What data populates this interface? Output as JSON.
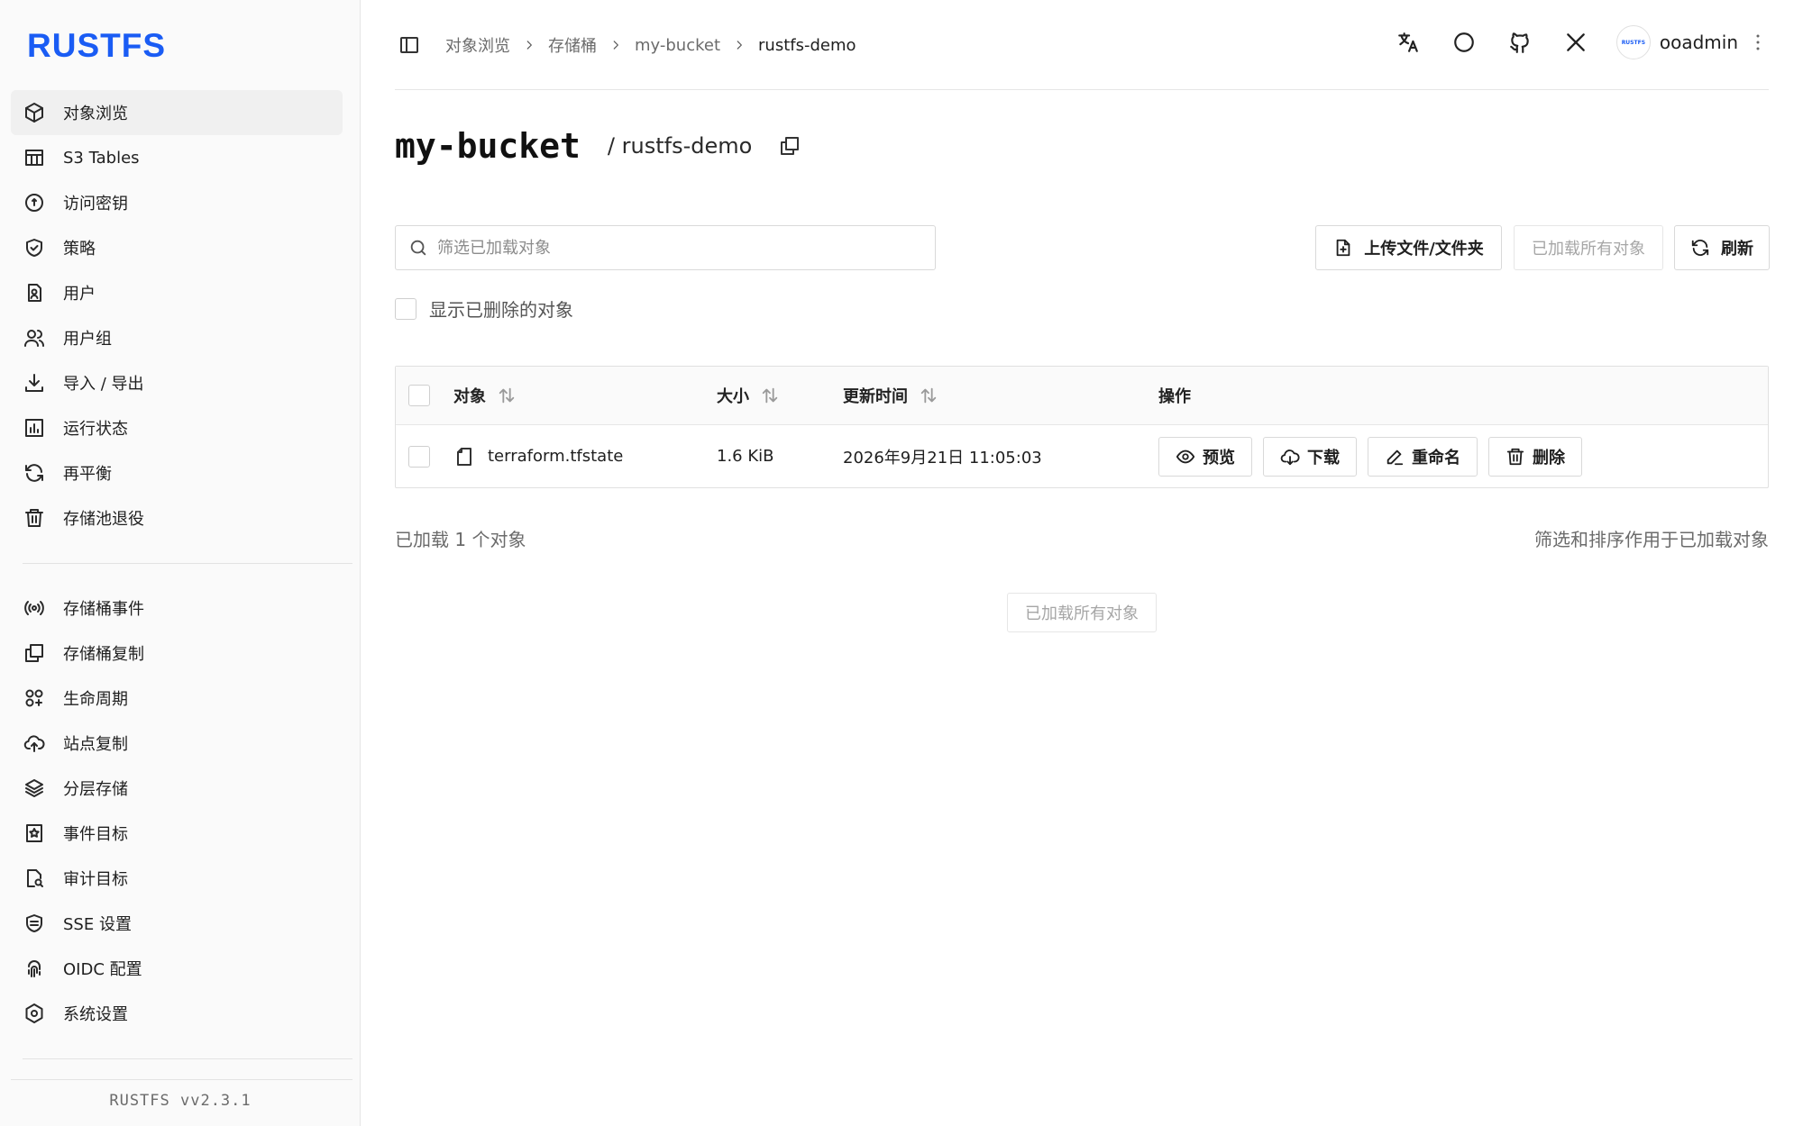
{
  "app": {
    "logo": "RUSTFS",
    "version": "RUSTFS  vv2.3.1",
    "accent": "#1a5cf4"
  },
  "sidebar": {
    "primary": [
      {
        "label": "对象浏览",
        "icon": "cube-icon",
        "active": true
      },
      {
        "label": "S3 Tables",
        "icon": "table-icon"
      },
      {
        "label": "访问密钥",
        "icon": "key-circle-icon"
      },
      {
        "label": "策略",
        "icon": "shield-check-icon"
      },
      {
        "label": "用户",
        "icon": "user-badge-icon"
      },
      {
        "label": "用户组",
        "icon": "users-icon"
      },
      {
        "label": "导入 / 导出",
        "icon": "download-tray-icon"
      },
      {
        "label": "运行状态",
        "icon": "bar-chart-icon"
      },
      {
        "label": "再平衡",
        "icon": "refresh-icon"
      },
      {
        "label": "存储池退役",
        "icon": "trash-icon"
      }
    ],
    "secondary": [
      {
        "label": "存储桶事件",
        "icon": "broadcast-icon"
      },
      {
        "label": "存储桶复制",
        "icon": "copy-icon"
      },
      {
        "label": "生命周期",
        "icon": "lifecycle-icon"
      },
      {
        "label": "站点复制",
        "icon": "cloud-upload-icon"
      },
      {
        "label": "分层存储",
        "icon": "layers-icon"
      },
      {
        "label": "事件目标",
        "icon": "star-bookmark-icon"
      },
      {
        "label": "审计目标",
        "icon": "file-search-icon"
      },
      {
        "label": "SSE 设置",
        "icon": "encryption-icon"
      },
      {
        "label": "OIDC 配置",
        "icon": "fingerprint-icon"
      },
      {
        "label": "系统设置",
        "icon": "hex-settings-icon"
      }
    ]
  },
  "header": {
    "breadcrumb": [
      "对象浏览",
      "存储桶",
      "my-bucket",
      "rustfs-demo"
    ],
    "user": {
      "name": "ooadmin",
      "avatar_text": "RUSTFS"
    }
  },
  "page": {
    "bucket": "my-bucket",
    "path": "/ rustfs-demo"
  },
  "toolbar": {
    "search_placeholder": "筛选已加载对象",
    "upload_label": "上传文件/文件夹",
    "load_all_label": "已加载所有对象",
    "refresh_label": "刷新",
    "show_deleted_label": "显示已删除的对象"
  },
  "table": {
    "columns": {
      "name": "对象",
      "size": "大小",
      "time": "更新时间",
      "ops": "操作"
    },
    "rows": [
      {
        "name": "terraform.tfstate",
        "size": "1.6 KiB",
        "updated": "2026年9月21日 11:05:03",
        "ops": {
          "preview": "预览",
          "download": "下载",
          "rename": "重命名",
          "delete": "删除"
        }
      }
    ]
  },
  "footer": {
    "loaded_count": "已加载 1 个对象",
    "filter_note": "筛选和排序作用于已加载对象",
    "load_all_label": "已加载所有对象"
  }
}
